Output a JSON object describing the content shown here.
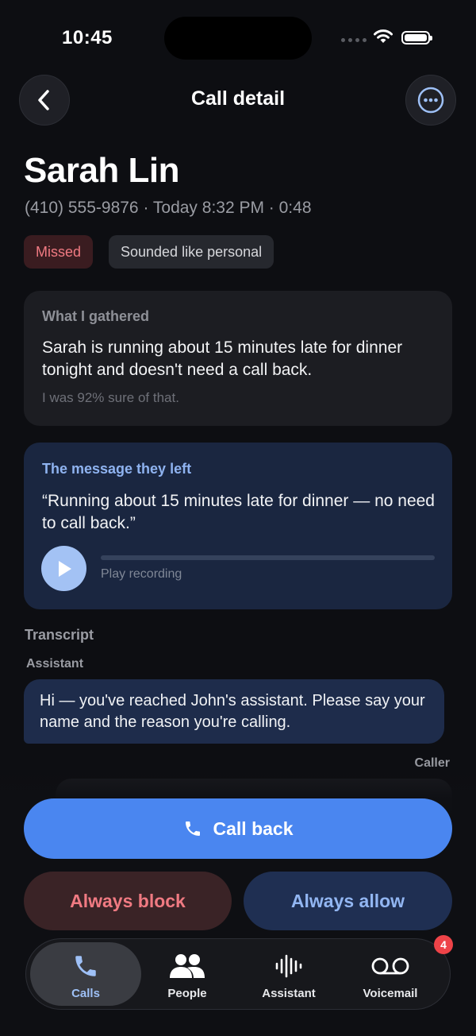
{
  "status_bar": {
    "time": "10:45"
  },
  "header": {
    "title": "Call detail",
    "back_icon": "chevron-left-icon",
    "more_icon": "ellipsis-circle-icon"
  },
  "contact": {
    "name": "Sarah Lin",
    "meta": "(410) 555-9876 · Today 8:32 PM · 0:48",
    "chips": {
      "missed": "Missed",
      "category": "Sounded like personal"
    }
  },
  "gathered": {
    "label": "What I gathered",
    "text": "Sarah is running about 15 minutes late for dinner tonight and doesn't need a call back.",
    "confidence": "I was 92% sure of that."
  },
  "message": {
    "label": "The message they left",
    "quote": "“Running about 15 minutes late for dinner — no need to call back.”",
    "play_label": "Play recording",
    "progress": 0
  },
  "transcript": {
    "label": "Transcript",
    "assistant_label": "Assistant",
    "assistant_text": "Hi — you've reached John's assistant. Please say your name and the reason you're calling.",
    "caller_label": "Caller",
    "caller_text": ""
  },
  "actions": {
    "call_back": "Call back",
    "always_block": "Always block",
    "always_allow": "Always allow"
  },
  "tabs": [
    {
      "label": "Calls",
      "icon": "phone-icon",
      "active": true
    },
    {
      "label": "People",
      "icon": "people-icon"
    },
    {
      "label": "Assistant",
      "icon": "waveform-icon"
    },
    {
      "label": "Voicemail",
      "icon": "voicemail-icon",
      "badge": "4"
    }
  ],
  "colors": {
    "background": "#0d0e12",
    "accent": "#4a86f0",
    "danger": "#f07a82",
    "badge": "#ee4348"
  }
}
